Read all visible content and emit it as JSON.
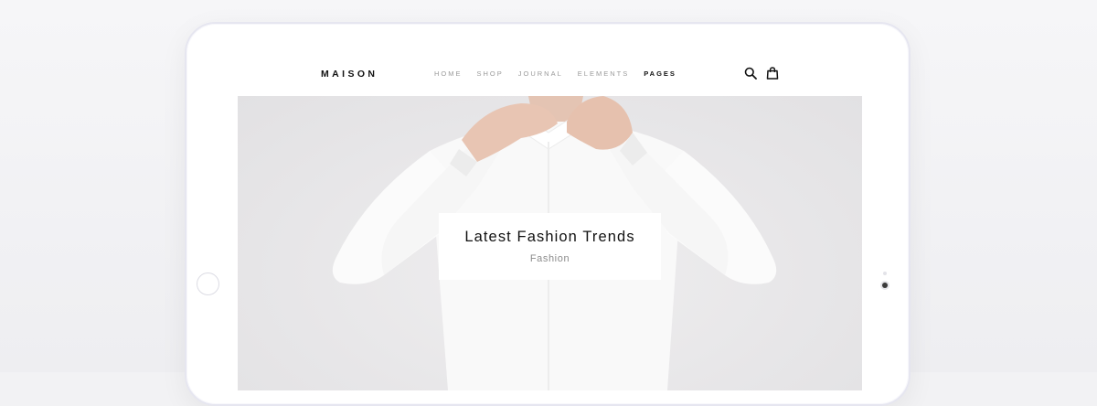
{
  "site": {
    "logo": "MAISON",
    "nav": [
      {
        "label": "HOME",
        "active": false
      },
      {
        "label": "SHOP",
        "active": false
      },
      {
        "label": "JOURNAL",
        "active": false
      },
      {
        "label": "ELEMENTS",
        "active": false
      },
      {
        "label": "PAGES",
        "active": true
      }
    ],
    "icons": [
      "search-icon",
      "shopping-bag-icon"
    ]
  },
  "hero": {
    "title": "Latest Fashion Trends",
    "category": "Fashion"
  },
  "colors": {
    "text_dark": "#111111",
    "nav_muted": "#9a9a9a",
    "hero_bg": "#e9e8ea",
    "shirt": "#f8f8f8",
    "skin": "#e9c9b8"
  }
}
